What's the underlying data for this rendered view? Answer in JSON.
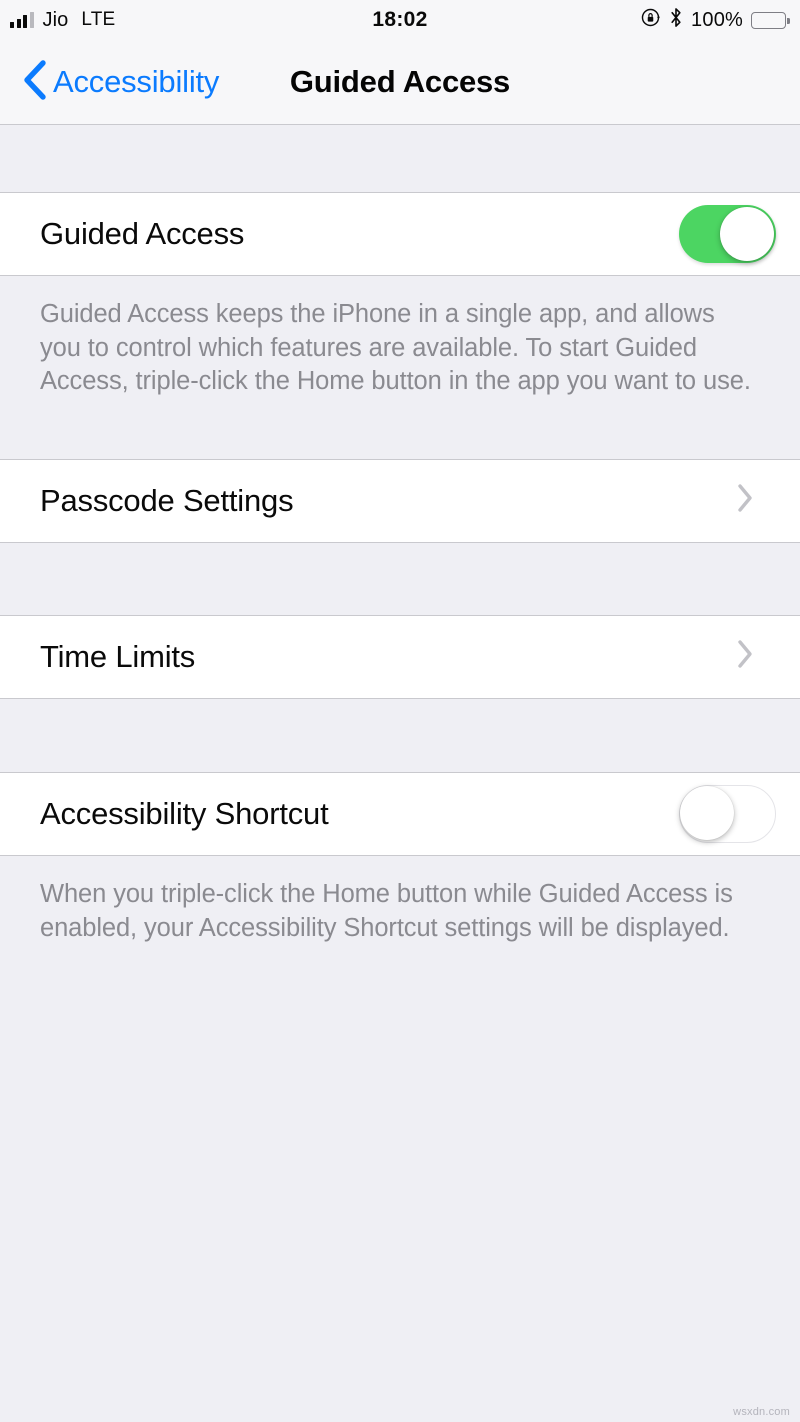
{
  "status_bar": {
    "signal_icon": "signal-bars-icon",
    "signal_bars_filled": 3,
    "signal_bars_total": 4,
    "carrier": "Jio",
    "network": "LTE",
    "time": "18:02",
    "rotation_lock_icon": "rotation-lock-icon",
    "bluetooth_icon": "bluetooth-icon",
    "battery_percent": "100%",
    "battery_level": 100
  },
  "nav_bar": {
    "back_icon": "chevron-left-icon",
    "back_label": "Accessibility",
    "title": "Guided Access"
  },
  "sections": [
    {
      "rows": [
        {
          "label": "Guided Access",
          "control": "switch",
          "value": "on"
        }
      ],
      "footer": "Guided Access keeps the iPhone in a single app, and allows you to control which features are available. To start Guided Access, triple-click the Home button in the app you want to use."
    },
    {
      "rows": [
        {
          "label": "Passcode Settings",
          "control": "disclosure",
          "value": ""
        }
      ],
      "footer": ""
    },
    {
      "rows": [
        {
          "label": "Time Limits",
          "control": "disclosure",
          "value": ""
        }
      ],
      "footer": ""
    },
    {
      "rows": [
        {
          "label": "Accessibility Shortcut",
          "control": "switch",
          "value": "off"
        }
      ],
      "footer": "When you triple-click the Home button while Guided Access is enabled, your Accessibility Shortcut settings will be displayed."
    }
  ],
  "colors": {
    "accent_blue": "#0B7BFE",
    "switch_on_green": "#4CD562",
    "background": "#EFEFF4",
    "cell_background": "#FFFFFF",
    "footer_text": "#8A8A90",
    "separator": "#C9C9CE"
  },
  "watermark": "wsxdn.com"
}
